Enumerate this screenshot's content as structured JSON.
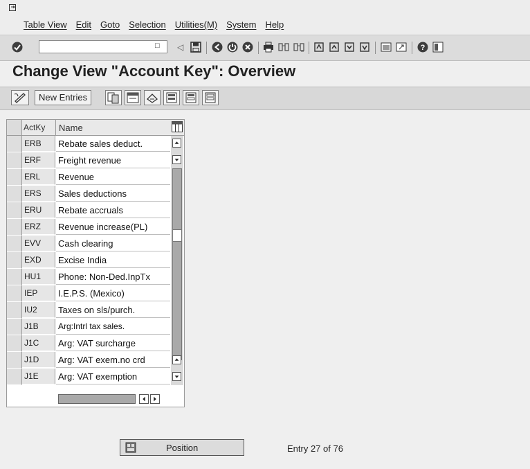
{
  "menu": {
    "items": [
      "Table View",
      "Edit",
      "Goto",
      "Selection",
      "Utilities(M)",
      "System",
      "Help"
    ]
  },
  "toolbar": {
    "command_value": "",
    "icons": [
      "enter-icon",
      "save-icon",
      "back-icon",
      "exit-icon",
      "cancel-icon",
      "print-icon",
      "find-icon",
      "find-next-icon",
      "first-page-icon",
      "previous-page-icon",
      "next-page-icon",
      "last-page-icon",
      "create-session-icon",
      "shortcut-icon",
      "help-icon",
      "customize-layout-icon"
    ]
  },
  "page": {
    "title": "Change View \"Account Key\": Overview"
  },
  "app_toolbar": {
    "new_entries": "New Entries",
    "icons": [
      "display-change-icon",
      "copy-icon",
      "delete-icon",
      "undo-icon",
      "select-all-icon",
      "select-block-icon",
      "deselect-all-icon"
    ]
  },
  "table": {
    "headers": {
      "key": "ActKy",
      "name": "Name"
    },
    "rows": [
      {
        "key": "ERB",
        "name": "Rebate sales deduct."
      },
      {
        "key": "ERF",
        "name": "Freight revenue"
      },
      {
        "key": "ERL",
        "name": "Revenue"
      },
      {
        "key": "ERS",
        "name": "Sales deductions"
      },
      {
        "key": "ERU",
        "name": "Rebate accruals"
      },
      {
        "key": "ERZ",
        "name": "Revenue increase(PL)"
      },
      {
        "key": "EVV",
        "name": "Cash clearing"
      },
      {
        "key": "EXD",
        "name": "Excise India"
      },
      {
        "key": "HU1",
        "name": "Phone: Non-Ded.InpTx"
      },
      {
        "key": "IEP",
        "name": "I.E.P.S. (Mexico)"
      },
      {
        "key": "IU2",
        "name": "Taxes on sls/purch."
      },
      {
        "key": "J1B",
        "name": "Arg:Intrl tax sales."
      },
      {
        "key": "J1C",
        "name": "Arg: VAT surcharge"
      },
      {
        "key": "J1D",
        "name": "Arg: VAT exem.no crd"
      },
      {
        "key": "J1E",
        "name": "Arg: VAT exemption"
      }
    ]
  },
  "footer": {
    "position_label": "Position",
    "entry_info": "Entry 27 of 76"
  },
  "colors": {
    "background": "#efefef",
    "toolbar": "#dcdcdc",
    "title": "#222222"
  }
}
